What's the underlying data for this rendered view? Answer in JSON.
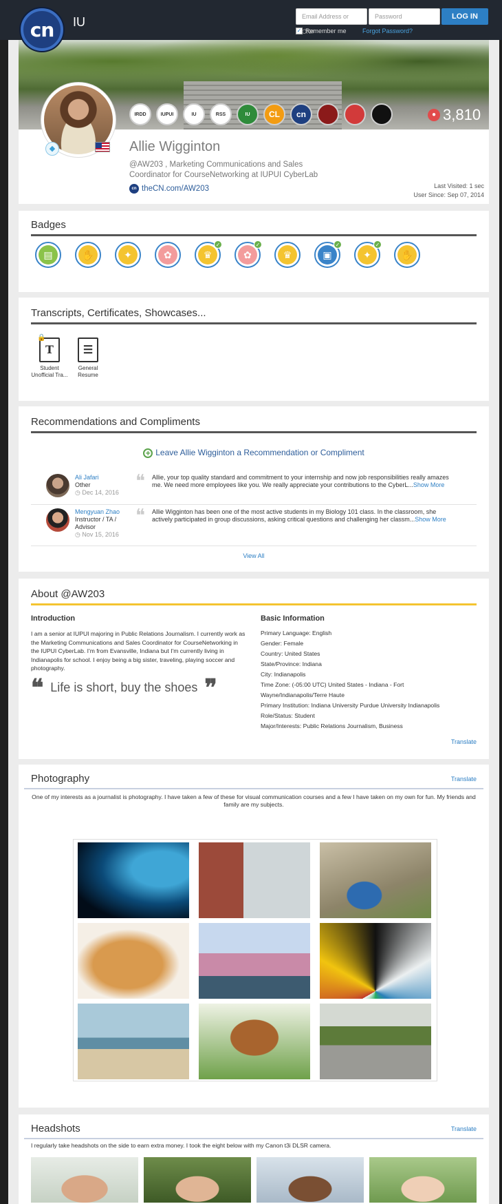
{
  "header": {
    "logo_text": "cn",
    "org": "IU",
    "email_placeholder": "Email Address or CN#",
    "password_placeholder": "Password",
    "login_label": "LOG IN",
    "remember_label": "Remember me",
    "forgot_label": "Forgot Password?"
  },
  "profile": {
    "name": "Allie Wigginton",
    "handle_line1": "@AW203 , Marketing Communications and Sales",
    "handle_line2": "Coordinator for CourseNetworking at IUPUI CyberLab",
    "link": "theCN.com/AW203",
    "last_visited": "Last Visited: 1 sec",
    "user_since": "User Since: Sep 07, 2014",
    "points": "3,810",
    "org_badges": [
      "IRDD",
      "IUPUI",
      "IU",
      "RSS",
      "IU",
      "CL",
      "cn",
      "",
      "",
      ""
    ]
  },
  "badges": {
    "title": "Badges",
    "items": [
      {
        "icon": "certificate-icon",
        "checked": false
      },
      {
        "icon": "hand-icon",
        "checked": false
      },
      {
        "icon": "lightbulb-icon",
        "checked": false
      },
      {
        "icon": "brain-icon",
        "checked": false
      },
      {
        "icon": "trophy-icon",
        "checked": true
      },
      {
        "icon": "brain-icon",
        "checked": true
      },
      {
        "icon": "trophy-icon",
        "checked": false
      },
      {
        "icon": "briefcase-icon",
        "checked": true
      },
      {
        "icon": "lightbulb-icon",
        "checked": true
      },
      {
        "icon": "hand-icon",
        "checked": false
      }
    ]
  },
  "transcripts": {
    "title": "Transcripts, Certificates, Showcases...",
    "doc1_line1": "Student",
    "doc1_line2": "Unofficial Tra...",
    "doc2_line1": "General",
    "doc2_line2": "Resume"
  },
  "recommendations": {
    "title": "Recommendations and Compliments",
    "leave_label": "Leave Allie Wigginton a Recommendation or Compliment",
    "items": [
      {
        "name": "Ali Jafari",
        "role": "Other",
        "date": "Dec 14, 2016",
        "text": "Allie, your top quality standard and commitment to your internship and now job responsibilities really amazes me. We need more employees like you. We really appreciate your contributions to the CyberL...",
        "more": "Show More"
      },
      {
        "name": "Mengyuan Zhao",
        "role": "Instructor / TA / Advisor",
        "date": "Nov 15, 2016",
        "text": "Allie Wigginton has been one of the most active students in my Biology 101 class. In the classroom, she actively participated in group discussions, asking critical questions and challenging her classm...",
        "more": "Show More"
      }
    ],
    "view_all": "View All"
  },
  "about": {
    "title": "About @AW203",
    "intro_heading": "Introduction",
    "intro_text": "I am a senior at IUPUI majoring in Public Relations Journalism. I currently work as the Marketing Communications and Sales Coordinator for CourseNetworking in the IUPUI CyberLab. I'm from Evansville, Indiana but I'm currently living in Indianapolis for school. I enjoy being a big sister, traveling, playing soccer and photography.",
    "quote": "Life is short, buy the shoes",
    "basic_heading": "Basic Information",
    "basic_rows": [
      "Primary Language:  English",
      "Gender:  Female",
      "Country:  United States",
      "State/Province:  Indiana",
      "City:  Indianapolis",
      "Time Zone:  (-05:00 UTC) United States - Indiana - Fort Wayne/Indianapolis/Terre Haute",
      "Primary Institution:  Indiana University Purdue University Indianapolis",
      "Role/Status:  Student",
      "Major/Interests:  Public Relations Journalism, Business"
    ],
    "translate": "Translate"
  },
  "photography": {
    "title": "Photography",
    "translate": "Translate",
    "description": "One of my interests as a journalist is photography. I have taken a few of these for visual communication courses and a few I have taken on my own for fun. My friends and family are my subjects."
  },
  "headshots": {
    "title": "Headshots",
    "translate": "Translate",
    "description": "I regularly take headshots on the side to earn extra money. I took the eight below with my Canon t3i DLSR camera."
  },
  "colors": {
    "accent": "#2d7fc4",
    "about_rule": "#f4c430",
    "topbar": "#222831"
  }
}
